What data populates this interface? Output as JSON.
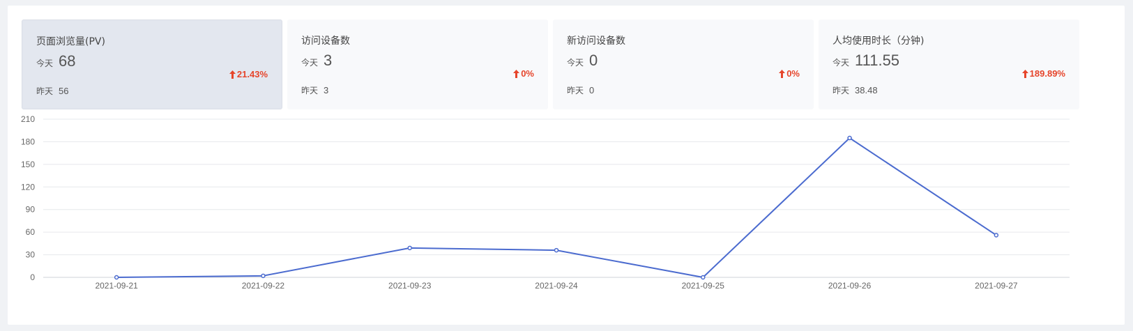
{
  "cards": [
    {
      "title": "页面浏览量(PV)",
      "today_label": "今天",
      "today_value": "68",
      "yesterday_label": "昨天",
      "yesterday_value": "56",
      "change": "21.43%",
      "active": true
    },
    {
      "title": "访问设备数",
      "today_label": "今天",
      "today_value": "3",
      "yesterday_label": "昨天",
      "yesterday_value": "3",
      "change": "0%",
      "active": false
    },
    {
      "title": "新访问设备数",
      "today_label": "今天",
      "today_value": "0",
      "yesterday_label": "昨天",
      "yesterday_value": "0",
      "change": "0%",
      "active": false
    },
    {
      "title": "人均使用时长（分钟)",
      "today_label": "今天",
      "today_value": "111.55",
      "yesterday_label": "昨天",
      "yesterday_value": "38.48",
      "change": "189.89%",
      "active": false
    }
  ],
  "colors": {
    "accent": "#4b6bcf",
    "up": "#e6452b",
    "active_card": "#e3e7ef",
    "card": "#f8f9fb"
  },
  "icons": {
    "change": "arrow-up-icon"
  },
  "chart_data": {
    "type": "line",
    "x": [
      "2021-09-21",
      "2021-09-22",
      "2021-09-23",
      "2021-09-24",
      "2021-09-25",
      "2021-09-26",
      "2021-09-27"
    ],
    "series": [
      {
        "values": [
          0,
          2,
          39,
          36,
          0,
          185,
          56
        ]
      }
    ],
    "yticks": [
      0,
      30,
      60,
      90,
      120,
      150,
      180,
      210
    ],
    "ylim": [
      0,
      210
    ],
    "grid": true,
    "legend": "none"
  }
}
